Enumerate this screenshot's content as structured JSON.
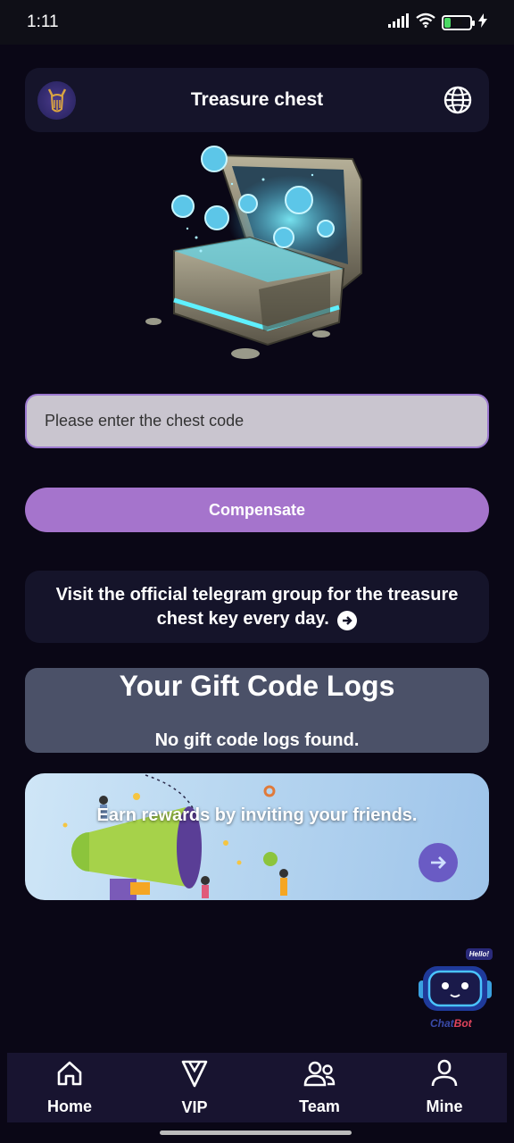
{
  "status_bar": {
    "time": "1:11",
    "battery": "24",
    "battery_level": 0.24
  },
  "header": {
    "title": "Treasure chest",
    "logo_icon": "viking-logo-icon",
    "language_icon": "globe-icon"
  },
  "chest_form": {
    "input_placeholder": "Please enter the chest code",
    "input_value": "",
    "submit_label": "Compensate"
  },
  "telegram_notice": {
    "text": "Visit the official telegram group for the treasure chest key every day.",
    "icon": "arrow-right-circle-icon"
  },
  "gift_logs": {
    "title": "Your Gift Code Logs",
    "empty_message": "No gift code logs found."
  },
  "invite_banner": {
    "text": "Earn rewards by inviting your friends.",
    "icon": "arrow-right-icon"
  },
  "chatbot": {
    "badge": "Hello!",
    "label_part1": "Chat",
    "label_part2": "Bot"
  },
  "bottom_nav": {
    "items": [
      {
        "label": "Home",
        "icon": "home-icon"
      },
      {
        "label": "VIP",
        "icon": "vip-diamond-icon"
      },
      {
        "label": "Team",
        "icon": "team-icon"
      },
      {
        "label": "Mine",
        "icon": "profile-icon"
      }
    ]
  },
  "colors": {
    "background": "#0a0716",
    "card": "#15142a",
    "accent": "#a574cc",
    "logs_card": "#4b5168"
  }
}
